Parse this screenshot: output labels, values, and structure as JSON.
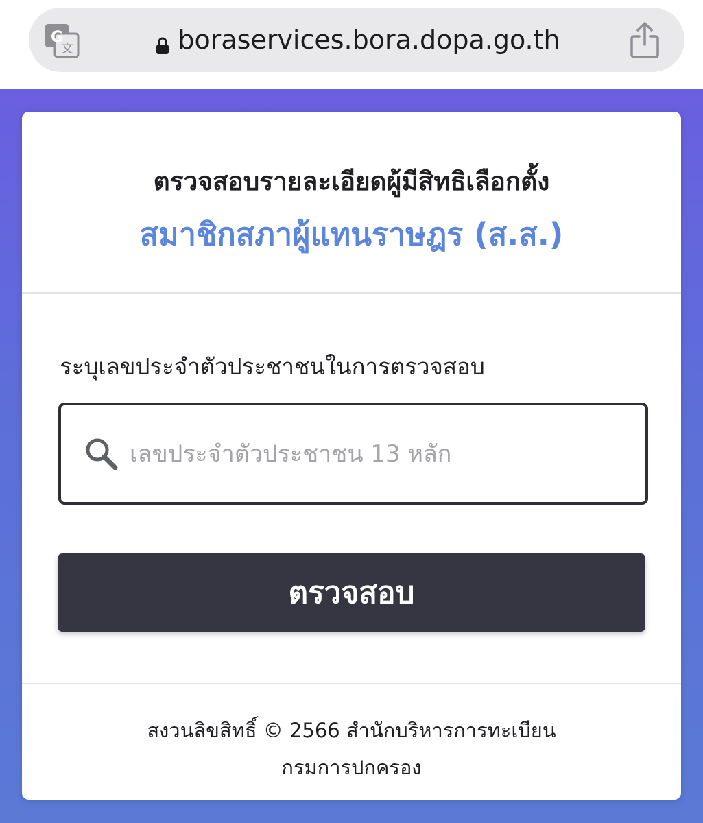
{
  "browser": {
    "url": "boraservices.bora.dopa.go.th",
    "icons": {
      "translate": "translate-icon",
      "lock": "lock-icon",
      "share": "share-icon"
    }
  },
  "header": {
    "title": "ตรวจสอบรายละเอียดผู้มีสิทธิเลือกตั้ง",
    "subtitle": "สมาชิกสภาผู้แทนราษฎร (ส.ส.)"
  },
  "form": {
    "label": "ระบุเลขประจำตัวประชาชนในการตรวจสอบ",
    "input_placeholder": "เลขประจำตัวประชาชน 13 หลัก",
    "input_value": "",
    "submit_label": "ตรวจสอบ",
    "search_icon": "search-icon"
  },
  "footer": {
    "copyright": "สงวนลิขสิทธิ์ © 2566 สำนักบริหารการทะเบียน",
    "organization": "กรมการปกครอง"
  },
  "colors": {
    "accent_blue": "#5b86dc",
    "button_dark": "#353641",
    "background_gradient_top": "#6a5fe0",
    "background_gradient_bottom": "#5a7ad6"
  }
}
